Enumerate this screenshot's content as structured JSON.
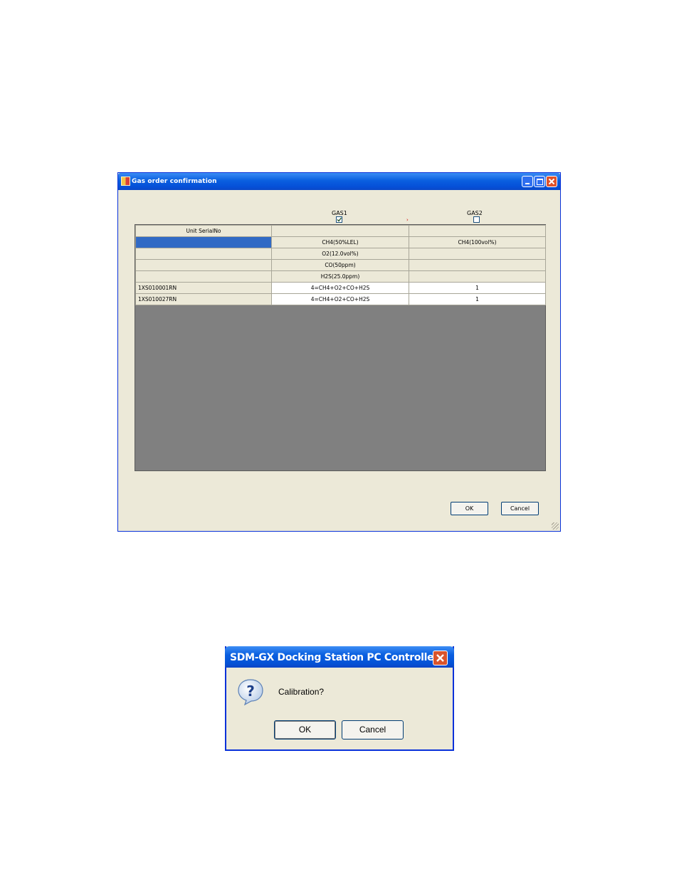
{
  "gas_window": {
    "title": "Gas order confirmation",
    "gas1_label": "GAS1",
    "gas1_checked": true,
    "gas2_label": "GAS2",
    "gas2_checked": false,
    "header_label": "Unit SerialNo",
    "gas_rows": [
      {
        "gas1": "CH4(50%LEL)",
        "gas2": "CH4(100vol%)"
      },
      {
        "gas1": "O2(12.0vol%)",
        "gas2": ""
      },
      {
        "gas1": "CO(50ppm)",
        "gas2": ""
      },
      {
        "gas1": "H2S(25.0ppm)",
        "gas2": ""
      }
    ],
    "data_rows": [
      {
        "serial": "1XS010001RN",
        "gas1": "4=CH4+O2+CO+H2S",
        "gas2": "1"
      },
      {
        "serial": "1XS010027RN",
        "gas1": "4=CH4+O2+CO+H2S",
        "gas2": "1"
      }
    ],
    "ok_label": "OK",
    "cancel_label": "Cancel"
  },
  "confirm_dialog": {
    "title": "SDM-GX Docking Station PC Controller",
    "message": "Calibration?",
    "icon": "question-icon",
    "ok_label": "OK",
    "cancel_label": "Cancel"
  },
  "colors": {
    "titlebar": "#0a5fe0",
    "window_bg": "#ece9d8",
    "selection": "#316ac5",
    "grid_empty": "#808080"
  }
}
